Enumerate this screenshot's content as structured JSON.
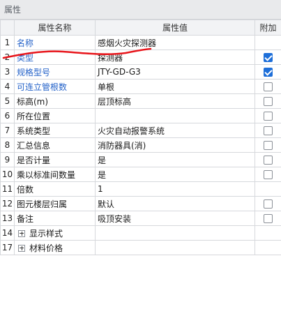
{
  "panel": {
    "title": "属性"
  },
  "columns": {
    "name": "属性名称",
    "value": "属性值",
    "add": "附加"
  },
  "rows": [
    {
      "num": "1",
      "name": "名称",
      "value": "感烟火灾探测器",
      "blue": true,
      "add": null
    },
    {
      "num": "2",
      "name": "类型",
      "value": "探测器",
      "blue": true,
      "add": true
    },
    {
      "num": "3",
      "name": "规格型号",
      "value": "JTY-GD-G3",
      "blue": true,
      "add": true
    },
    {
      "num": "4",
      "name": "可连立管根数",
      "value": "单根",
      "blue": true,
      "add": false
    },
    {
      "num": "5",
      "name": "标高(m)",
      "value": "层顶标高",
      "blue": false,
      "add": false
    },
    {
      "num": "6",
      "name": "所在位置",
      "value": "",
      "blue": false,
      "add": false
    },
    {
      "num": "7",
      "name": "系统类型",
      "value": "火灾自动报警系统",
      "blue": false,
      "add": false
    },
    {
      "num": "8",
      "name": "汇总信息",
      "value": "消防器具(消)",
      "blue": false,
      "add": false
    },
    {
      "num": "9",
      "name": "是否计量",
      "value": "是",
      "blue": false,
      "add": false
    },
    {
      "num": "10",
      "name": "乘以标准间数量",
      "value": "是",
      "blue": false,
      "add": false
    },
    {
      "num": "11",
      "name": "倍数",
      "value": "1",
      "blue": false,
      "add": null
    },
    {
      "num": "12",
      "name": "图元楼层归属",
      "value": "默认",
      "blue": false,
      "add": false
    },
    {
      "num": "13",
      "name": "备注",
      "value": "吸顶安装",
      "blue": false,
      "add": false
    }
  ],
  "groups": [
    {
      "num": "14",
      "label": "显示样式"
    },
    {
      "num": "17",
      "label": "材料价格"
    }
  ],
  "colors": {
    "link": "#2563c9",
    "annotation": "#e8141a",
    "check": "#1e6fd9"
  }
}
